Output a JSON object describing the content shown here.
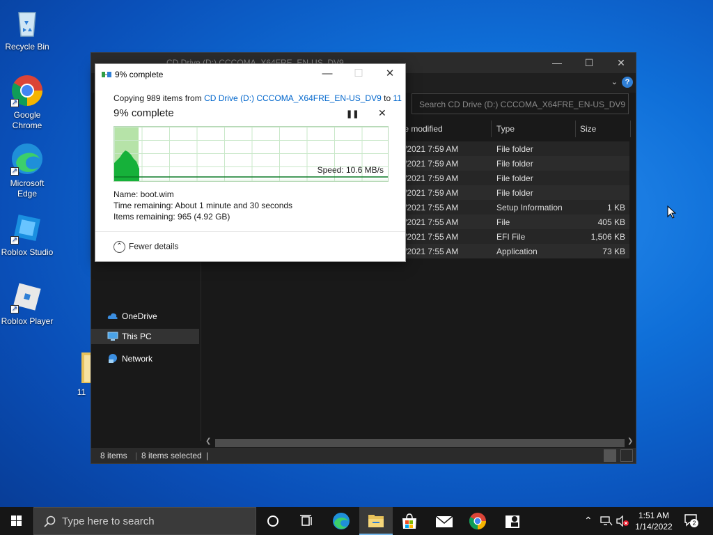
{
  "desktop": {
    "icons": [
      {
        "label": "Recycle Bin"
      },
      {
        "label": "Google\nChrome"
      },
      {
        "label": "Microsoft\nEdge"
      },
      {
        "label": "Roblox Studio"
      },
      {
        "label": "Roblox Player"
      },
      {
        "label": "11"
      }
    ]
  },
  "explorer": {
    "title": "CD Drive (D:) CCCOMA_X64FRE_EN-US_DV9",
    "search_placeholder": "Search CD Drive (D:) CCCOMA_X64FRE_EN-US_DV9",
    "nav": [
      {
        "label": "OneDrive"
      },
      {
        "label": "This PC"
      },
      {
        "label": "Network"
      }
    ],
    "columns": {
      "date": "te modified",
      "type": "Type",
      "size": "Size"
    },
    "rows": [
      {
        "date": "/2021 7:59 AM",
        "type": "File folder",
        "size": ""
      },
      {
        "date": "/2021 7:59 AM",
        "type": "File folder",
        "size": ""
      },
      {
        "date": "/2021 7:59 AM",
        "type": "File folder",
        "size": ""
      },
      {
        "date": "/2021 7:59 AM",
        "type": "File folder",
        "size": ""
      },
      {
        "date": "/2021 7:55 AM",
        "type": "Setup Information",
        "size": "1 KB"
      },
      {
        "date": "/2021 7:55 AM",
        "type": "File",
        "size": "405 KB"
      },
      {
        "date": "/2021 7:55 AM",
        "type": "EFI File",
        "size": "1,506 KB"
      },
      {
        "date": "/2021 7:55 AM",
        "type": "Application",
        "size": "73 KB"
      }
    ],
    "status": {
      "items": "8 items",
      "selected": "8 items selected"
    }
  },
  "copy_dialog": {
    "title": "9% complete",
    "copying_prefix": "Copying 989 items from ",
    "source": "CD Drive (D:) CCCOMA_X64FRE_EN-US_DV9",
    "to_word": " to ",
    "destination": "11",
    "percent_label": "9% complete",
    "progress_fraction": 0.09,
    "speed": "Speed: 10.6 MB/s",
    "name": "Name:  boot.wim",
    "time_remaining": "Time remaining:  About 1 minute and 30 seconds",
    "items_remaining": "Items remaining:  965 (4.92 GB)",
    "fewer_details": "Fewer details"
  },
  "taskbar": {
    "search_placeholder": "Type here to search",
    "time": "1:51 AM",
    "date": "1/14/2022",
    "notification_count": "2"
  },
  "colors": {
    "accent": "#0066cc",
    "graph_green": "#16b13a",
    "graph_fill": "#b6e3a8"
  }
}
